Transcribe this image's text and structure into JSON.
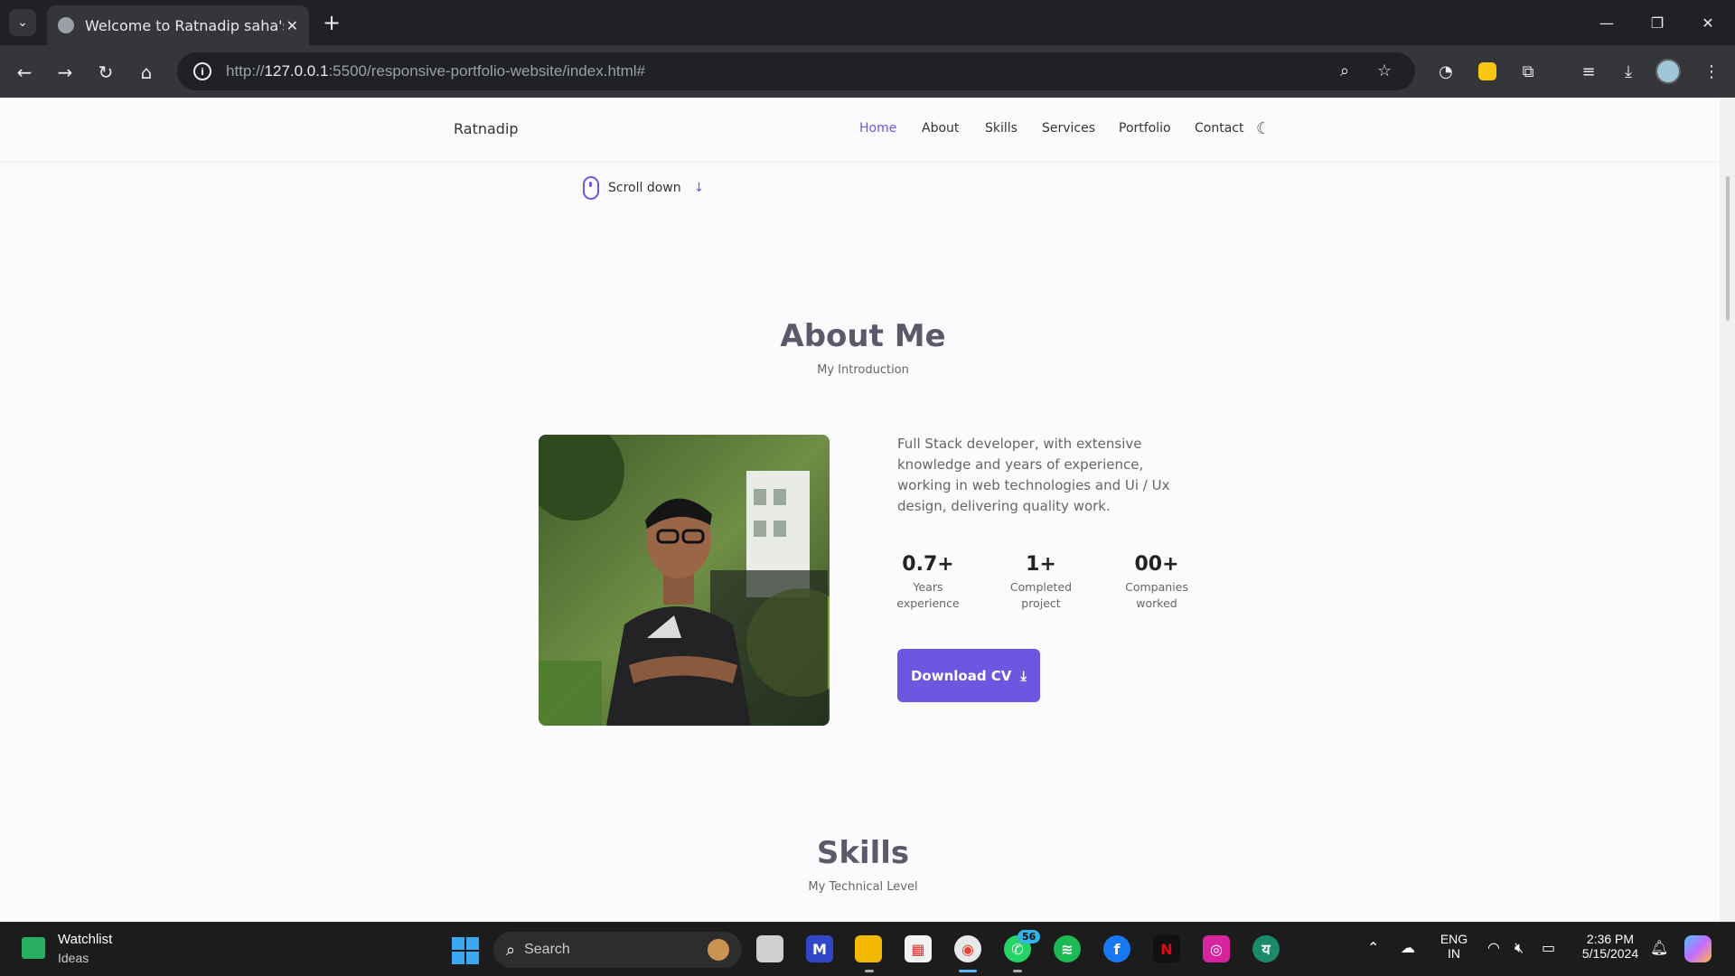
{
  "browser": {
    "tab_title": "Welcome to Ratnadip saha's po",
    "url_scheme": "http://",
    "url_host": "127.0.0.1",
    "url_rest": ":5500/responsive-portfolio-website/index.html#"
  },
  "header": {
    "logo": "Ratnadip",
    "nav": [
      "Home",
      "About",
      "Skills",
      "Services",
      "Portfolio",
      "Contact"
    ],
    "active": "Home"
  },
  "scroll_down": {
    "label": "Scroll down"
  },
  "about": {
    "title": "About Me",
    "subtitle": "My Introduction",
    "description": "Full Stack developer, with extensive knowledge and years of experience, working in web technologies and Ui / Ux design, delivering quality work.",
    "stats": [
      {
        "number": "0.7+",
        "label_1": "Years",
        "label_2": "experience"
      },
      {
        "number": "1+",
        "label_1": "Completed",
        "label_2": "project"
      },
      {
        "number": "00+",
        "label_1": "Companies",
        "label_2": "worked"
      }
    ],
    "button": "Download CV"
  },
  "skills": {
    "title": "Skills",
    "subtitle": "My Technical Level"
  },
  "taskbar": {
    "widget_title": "Watchlist",
    "widget_sub": "Ideas",
    "search": "Search",
    "whatsapp_badge": "56",
    "lang_1": "ENG",
    "lang_2": "IN",
    "time": "2:36 PM",
    "date": "5/15/2024"
  },
  "colors": {
    "accent": "#6e57e0",
    "title": "#5b5a6b",
    "page_bg": "#fbfbfe"
  },
  "icons": [
    "tab-list-icon",
    "close-icon",
    "plus-icon",
    "back-icon",
    "forward-icon",
    "reload-icon",
    "home-icon",
    "info-icon",
    "zoom-icon",
    "star-icon",
    "moon-icon",
    "mouse-icon",
    "arrow-down-icon",
    "download-icon"
  ]
}
